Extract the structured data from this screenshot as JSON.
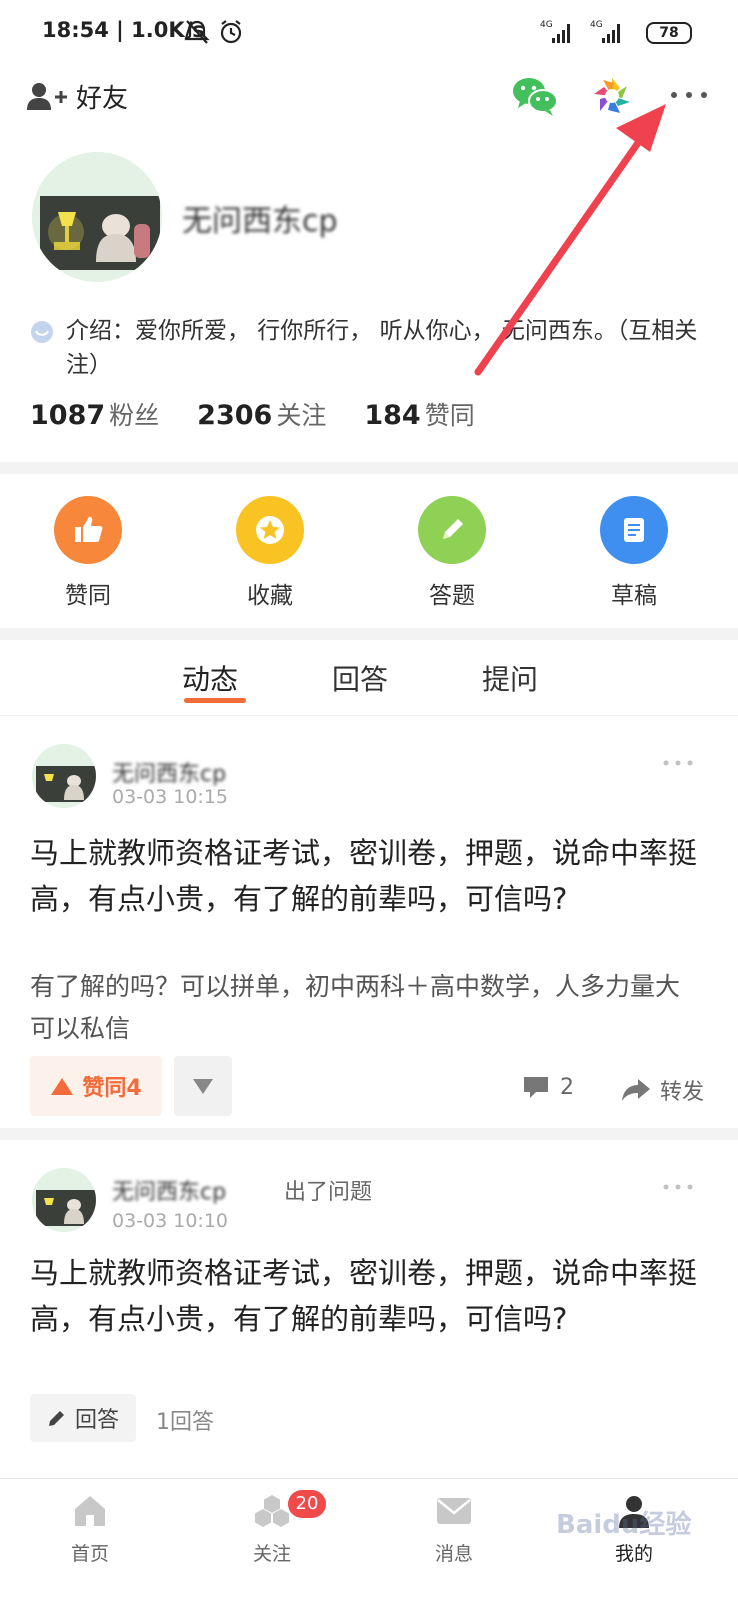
{
  "status_bar": {
    "time": "18:54",
    "speed": "| 1.0K/s",
    "battery": "78"
  },
  "topbar": {
    "add_friend_label": "好友"
  },
  "profile": {
    "nickname": "无问西东cp",
    "intro": "介绍：爱你所爱， 行你所行， 听从你心， 无问西东。（互相关注）"
  },
  "stats": [
    {
      "value": "1087",
      "label": "粉丝"
    },
    {
      "value": "2306",
      "label": "关注"
    },
    {
      "value": "184",
      "label": "赞同"
    }
  ],
  "quick_actions": [
    {
      "label": "赞同",
      "color": "#f7873a"
    },
    {
      "label": "收藏",
      "color": "#f9c324"
    },
    {
      "label": "答题",
      "color": "#8fd155"
    },
    {
      "label": "草稿",
      "color": "#3f8ff0"
    }
  ],
  "tabs": [
    "动态",
    "回答",
    "提问"
  ],
  "feed": [
    {
      "author": "无问西东cp",
      "time": "03-03 10:15",
      "title": "马上就教师资格证考试，密训卷，押题，说命中率挺高，有点小贵，有了解的前辈吗，可信吗?",
      "desc": "有了解的吗？可以拼单，初中两科＋高中数学，人多力量大 可以私信",
      "vote_label": "赞同4",
      "comments": "2",
      "forward_label": "转发"
    },
    {
      "author": "无问西东cp",
      "action": "出了问题",
      "time": "03-03 10:10",
      "title": "马上就教师资格证考试，密训卷，押题，说命中率挺高，有点小贵，有了解的前辈吗，可信吗?",
      "answer_label": "回答",
      "answer_count": "1回答"
    }
  ],
  "bottom_nav": [
    {
      "label": "首页"
    },
    {
      "label": "关注",
      "badge": "20"
    },
    {
      "label": "消息"
    },
    {
      "label": "我的"
    }
  ],
  "watermark": "Baidu经验",
  "colors": {
    "accent": "#f26b3a",
    "annotation_arrow": "#f0424e"
  }
}
